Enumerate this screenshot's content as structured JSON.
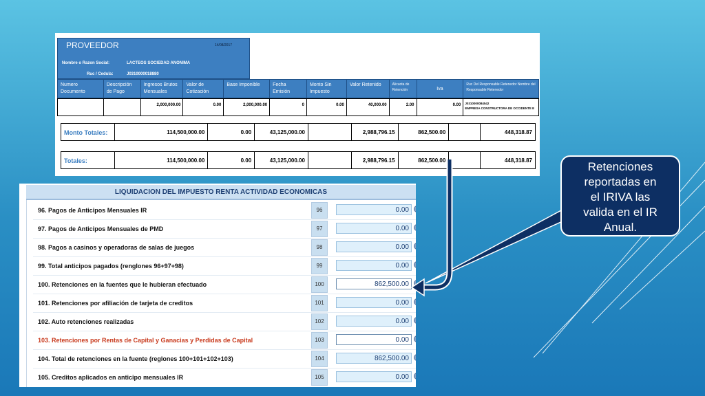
{
  "provider": {
    "title": "PROVEEDOR",
    "date": "14/08/2017",
    "razon_label": "Nombre o Razon Social:",
    "razon_value": "LACTEOS SOCIEDAD ANONIMA",
    "ruc_label": "Ruc / Cedula:",
    "ruc_value": "J0310000018880",
    "columns": [
      "Numero Documento",
      "Descripción de Pago",
      "Ingresos Brutos Mensuales",
      "Valor de Cotización",
      "Base Imponible",
      "Fecha Emisión",
      "Monto Sin Impuesto",
      "Valor Retenido",
      "Alicuota de Retención",
      "Iva",
      "Ruc Del Responsable Retenedor Nombre del Responsable Retenedor"
    ],
    "row": [
      "",
      "",
      "2,000,000.00",
      "0.00",
      "2,000,000.00",
      "0",
      "0.00",
      "40,000.00",
      "2.00",
      "0.00"
    ],
    "row_ruc": "J0310000084542",
    "row_empresa": "EMPRESA CONSTRUCTORA DE OCCIDENTE E",
    "monto_totales": {
      "label": "Monto Totales:",
      "values": [
        "114,500,000.00",
        "0.00",
        "43,125,000.00",
        "",
        "2,988,796.15",
        "862,500.00",
        "",
        "448,318.87"
      ]
    },
    "totales": {
      "label": "Totales:",
      "values": [
        "114,500,000.00",
        "0.00",
        "43,125,000.00",
        "",
        "2,988,796.15",
        "862,500.00",
        "",
        "448,318.87"
      ]
    }
  },
  "liquidacion": {
    "title": "LIQUIDACION DEL IMPUESTO RENTA ACTIVIDAD ECONOMICAS",
    "rows": [
      {
        "label": "96. Pagos de Anticipos Mensuales IR",
        "num": "96",
        "value": "0.00"
      },
      {
        "label": "97. Pagos de Anticipos Mensuales de PMD",
        "num": "97",
        "value": "0.00"
      },
      {
        "label": "98. Pagos a casinos y operadoras de salas de juegos",
        "num": "98",
        "value": "0.00"
      },
      {
        "label": "99. Total anticipos pagados (renglones 96+97+98)",
        "num": "99",
        "value": "0.00"
      },
      {
        "label": "100. Retenciones en la fuentes que le hubieran efectuado",
        "num": "100",
        "value": "862,500.00"
      },
      {
        "label": "101. Retenciones por afiliación de tarjeta de creditos",
        "num": "101",
        "value": "0.00"
      },
      {
        "label": "102. Auto retenciones realizadas",
        "num": "102",
        "value": "0.00"
      },
      {
        "label": "103. Retenciones por Rentas de Capital y Ganacias y Perdidas de Capital",
        "num": "103",
        "value": "0.00"
      },
      {
        "label": "104. Total de retenciones en la fuente (reglones 100+101+102+103)",
        "num": "104",
        "value": "862,500.00"
      },
      {
        "label": "105. Creditos aplicados en anticipo mensuales IR",
        "num": "105",
        "value": "0.00"
      }
    ]
  },
  "callout": {
    "line1": "Retenciones",
    "line2": "reportadas en",
    "line3": "el IRIVA las",
    "line4": "valida en el IR",
    "line5": "Anual."
  },
  "colors": {
    "background_top": "#5bc3e3",
    "background_bottom": "#1a78b8",
    "header_blue": "#3d7fc1",
    "callout_bg": "#0d2f63",
    "highlight_red": "#c8391c"
  },
  "icons": {
    "edit": "pencil-icon"
  }
}
